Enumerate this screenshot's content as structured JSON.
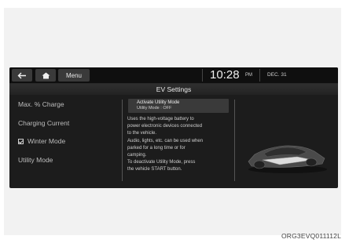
{
  "topbar": {
    "back_icon": "arrow-left-icon",
    "home_icon": "home-icon",
    "menu_label": "Menu",
    "time": "10:28",
    "ampm": "PM",
    "date": "DEC. 31"
  },
  "title": "EV Settings",
  "sidebar": {
    "items": [
      {
        "label": "Max. % Charge"
      },
      {
        "label": "Charging Current"
      },
      {
        "label": "Winter Mode",
        "checked": true
      },
      {
        "label": "Utility Mode"
      }
    ]
  },
  "utility": {
    "activate_label": "Activate Utility Mode",
    "status_label": "Utility Mode : OFF",
    "description_lines": [
      "Uses the high-voltage battery to",
      "power electronic devices connected",
      "to the vehicle.",
      "Audio, lights, etc. can be used when",
      "parked for a long time or for",
      "camping.",
      "To deactivate Utility Mode, press",
      "the vehicle START button."
    ]
  },
  "caption": "ORG3EVQ011112L",
  "colors": {
    "screen_bg": "#1c1c1c",
    "button_bg": "#3a3a3a",
    "text": "#bdbdbd"
  }
}
